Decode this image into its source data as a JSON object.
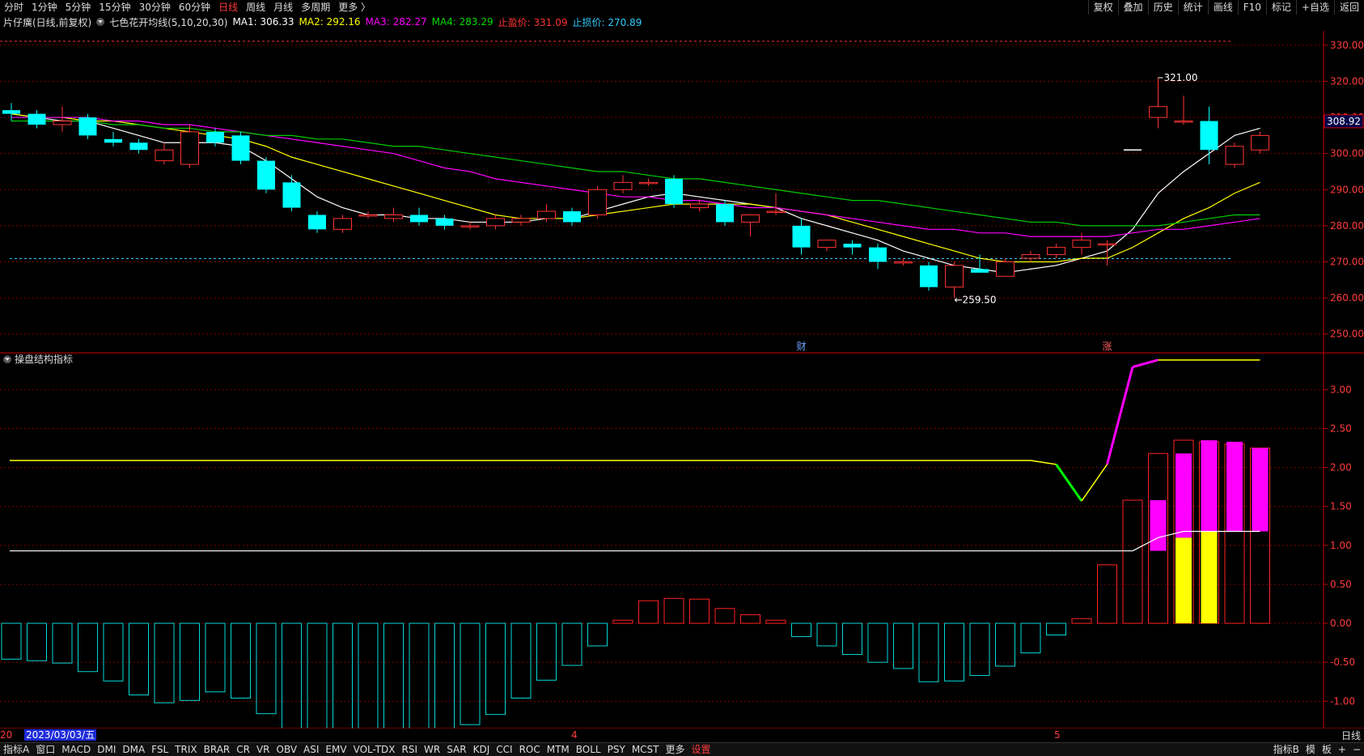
{
  "toolbar": {
    "periods": [
      {
        "label": "分时",
        "active": false
      },
      {
        "label": "1分钟",
        "active": false
      },
      {
        "label": "5分钟",
        "active": false
      },
      {
        "label": "15分钟",
        "active": false
      },
      {
        "label": "30分钟",
        "active": false
      },
      {
        "label": "60分钟",
        "active": false
      },
      {
        "label": "日线",
        "active": true
      },
      {
        "label": "周线",
        "active": false
      },
      {
        "label": "月线",
        "active": false
      },
      {
        "label": "多周期",
        "active": false
      },
      {
        "label": "更多 〉",
        "active": false
      }
    ],
    "right_items": [
      "复权",
      "叠加",
      "历史",
      "统计",
      "画线",
      "F10",
      "标记",
      "+自选",
      "返回"
    ]
  },
  "info": {
    "stock": "片仔癀(日线,前复权)",
    "indicator": "七色花开均线(5,10,20,30)",
    "ma1": "MA1: 306.33",
    "ma2": "MA2: 292.16",
    "ma3": "MA3: 282.27",
    "ma4": "MA4: 283.29",
    "take_profit": "止盈价: 331.09",
    "stop_loss": "止损价: 270.89"
  },
  "colors": {
    "ma1": "#ffffff",
    "ma2": "#ffff00",
    "ma3": "#ff00ff",
    "ma4": "#00cc00",
    "up": "#ff3333",
    "down": "#00ffff",
    "grid": "#7a0000",
    "axis": "#cc0000"
  },
  "price_axis": {
    "ticks": [
      "330.00",
      "320.00",
      "310.00",
      "300.00",
      "290.00",
      "280.00",
      "270.00",
      "260.00",
      "250.00"
    ],
    "current": "308.92",
    "high_label": "321.00",
    "low_label": "259.50",
    "event_cai": "财",
    "event_zhang": "涨"
  },
  "indicator": {
    "title": "操盘结构指标",
    "ticks": [
      "3.00",
      "2.50",
      "2.00",
      "1.50",
      "1.00",
      "0.50",
      "0.00",
      "-0.50",
      "-1.00"
    ]
  },
  "datebar": {
    "left": "20",
    "selected_date": "2023/03/03/五",
    "month4": "4",
    "month5": "5",
    "right_label": "日线"
  },
  "bottombar": {
    "items": [
      "指标A",
      "窗口",
      "MACD",
      "DMI",
      "DMA",
      "FSL",
      "TRIX",
      "BRAR",
      "CR",
      "VR",
      "OBV",
      "ASI",
      "EMV",
      "VOL-TDX",
      "RSI",
      "WR",
      "SAR",
      "KDJ",
      "CCI",
      "ROC",
      "MTM",
      "BOLL",
      "PSY",
      "MCST",
      "更多",
      "设置"
    ],
    "right_items": [
      "指标B",
      "模",
      "板",
      "+",
      "−"
    ]
  },
  "chart_data": {
    "type": "candlestick",
    "candles": [
      [
        312,
        314,
        309,
        311
      ],
      [
        311,
        312,
        307,
        308
      ],
      [
        308,
        313,
        306,
        309
      ],
      [
        310,
        311,
        304,
        305
      ],
      [
        304,
        306,
        302,
        303
      ],
      [
        303,
        304,
        300,
        301
      ],
      [
        298,
        303,
        297,
        301
      ],
      [
        297,
        308,
        296,
        306
      ],
      [
        306,
        307,
        302,
        303
      ],
      [
        305,
        306,
        297,
        298
      ],
      [
        298,
        299,
        289,
        290
      ],
      [
        292,
        294,
        284,
        285
      ],
      [
        283,
        284,
        278,
        279
      ],
      [
        279,
        283,
        278,
        282
      ],
      [
        283,
        284,
        282,
        283
      ],
      [
        282,
        285,
        281,
        283
      ],
      [
        283,
        285,
        280,
        281
      ],
      [
        282,
        283,
        279,
        280
      ],
      [
        280,
        281,
        279,
        280
      ],
      [
        280,
        283,
        279,
        282
      ],
      [
        281,
        283,
        280,
        282
      ],
      [
        282,
        286,
        281,
        284
      ],
      [
        284,
        285,
        280,
        281
      ],
      [
        283,
        291,
        282,
        290
      ],
      [
        290,
        294,
        289,
        292
      ],
      [
        292,
        293,
        291,
        292
      ],
      [
        293,
        294,
        285,
        286
      ],
      [
        285,
        287,
        284,
        286
      ],
      [
        286,
        287,
        280,
        281
      ],
      [
        281,
        283,
        277,
        283
      ],
      [
        284,
        289,
        283,
        284
      ],
      [
        280,
        282,
        272,
        274
      ],
      [
        274,
        276,
        273,
        276
      ],
      [
        275,
        276,
        272,
        274
      ],
      [
        274,
        275,
        268,
        270
      ],
      [
        270,
        271,
        269,
        270
      ],
      [
        269,
        270,
        262,
        263
      ],
      [
        263,
        270,
        260,
        269
      ],
      [
        268,
        272,
        267,
        267
      ],
      [
        266,
        271,
        266,
        270
      ],
      [
        271,
        273,
        270,
        272
      ],
      [
        272,
        275,
        271,
        274
      ],
      [
        274,
        278,
        272,
        276
      ],
      [
        275,
        276,
        269,
        275
      ],
      [
        301,
        301,
        301,
        301
      ],
      [
        310,
        321,
        307,
        313
      ],
      [
        309,
        316,
        308,
        309
      ],
      [
        309,
        313,
        297,
        301
      ],
      [
        297,
        303,
        296,
        302
      ],
      [
        301,
        306,
        300,
        305
      ]
    ],
    "ma_series": [
      {
        "name": "MA1",
        "values": [
          311,
          310,
          309,
          309,
          307,
          305,
          303,
          303,
          303,
          302,
          298,
          293,
          288,
          285,
          283,
          283,
          282,
          282,
          281,
          281,
          281,
          282,
          282,
          284,
          286,
          288,
          289,
          288,
          287,
          286,
          285,
          282,
          280,
          278,
          276,
          273,
          271,
          269,
          268,
          267,
          268,
          269,
          271,
          273,
          279,
          289,
          295,
          300,
          305,
          307
        ]
      },
      {
        "name": "MA2",
        "values": [
          311,
          310,
          310,
          309,
          309,
          308,
          307,
          306,
          305,
          304,
          302,
          299,
          297,
          295,
          293,
          291,
          289,
          287,
          285,
          283,
          282,
          282,
          282,
          283,
          284,
          285,
          286,
          286,
          286,
          286,
          285,
          284,
          283,
          281,
          279,
          277,
          275,
          273,
          271,
          270,
          270,
          270,
          271,
          271,
          274,
          278,
          282,
          285,
          289,
          292
        ]
      },
      {
        "name": "MA3",
        "values": [
          310,
          310,
          310,
          310,
          309,
          309,
          308,
          308,
          307,
          306,
          305,
          304,
          303,
          302,
          301,
          300,
          298,
          296,
          295,
          293,
          292,
          291,
          290,
          289,
          288,
          288,
          287,
          287,
          286,
          285,
          285,
          284,
          283,
          282,
          281,
          280,
          279,
          279,
          278,
          278,
          277,
          277,
          277,
          277,
          278,
          279,
          279,
          280,
          281,
          282
        ]
      },
      {
        "name": "MA4",
        "values": [
          309,
          309,
          309,
          309,
          308,
          308,
          307,
          307,
          306,
          306,
          305,
          305,
          304,
          304,
          303,
          302,
          302,
          301,
          300,
          299,
          298,
          297,
          296,
          295,
          295,
          294,
          293,
          293,
          292,
          291,
          290,
          289,
          288,
          287,
          287,
          286,
          285,
          284,
          283,
          282,
          281,
          281,
          280,
          280,
          280,
          280,
          281,
          282,
          283,
          283
        ]
      }
    ],
    "hlines": {
      "take_profit": 331.09,
      "stop_loss": 270.89
    },
    "ylim": [
      245,
      334
    ],
    "indicator": {
      "ylim": [
        -1.35,
        3.45
      ],
      "bars": [
        -0.46,
        -0.48,
        -0.51,
        -0.62,
        -0.74,
        -0.92,
        -1.02,
        -0.99,
        -0.88,
        -0.96,
        -1.16,
        -1.44,
        -1.72,
        -1.85,
        -1.82,
        -1.66,
        -1.55,
        -1.45,
        -1.3,
        -1.17,
        -0.96,
        -0.73,
        -0.54,
        -0.29,
        0.04,
        0.29,
        0.32,
        0.31,
        0.19,
        0.11,
        0.04,
        -0.17,
        -0.29,
        -0.4,
        -0.5,
        -0.58,
        -0.75,
        -0.74,
        -0.67,
        -0.55,
        -0.38,
        -0.15,
        0.06,
        0.75,
        1.58,
        2.18,
        2.35,
        2.33,
        2.3,
        2.25
      ],
      "yellow_line": 2.09,
      "white_line": 0.93,
      "upper_curve": [
        2.09,
        2.04,
        1.57,
        2.04,
        3.29,
        3.38,
        3.38,
        3.38,
        3.38,
        3.38
      ],
      "white_tail": [
        0.93,
        1.1,
        1.18,
        1.18,
        1.18,
        1.18
      ],
      "magenta_boxes": [
        [
          0.93,
          1.58
        ],
        [
          1.1,
          2.18
        ],
        [
          1.18,
          2.35
        ],
        [
          1.18,
          2.33
        ],
        [
          1.18,
          2.25
        ]
      ],
      "yellow_boxes": [
        [
          0,
          1.1
        ],
        [
          0,
          1.18
        ]
      ]
    }
  }
}
